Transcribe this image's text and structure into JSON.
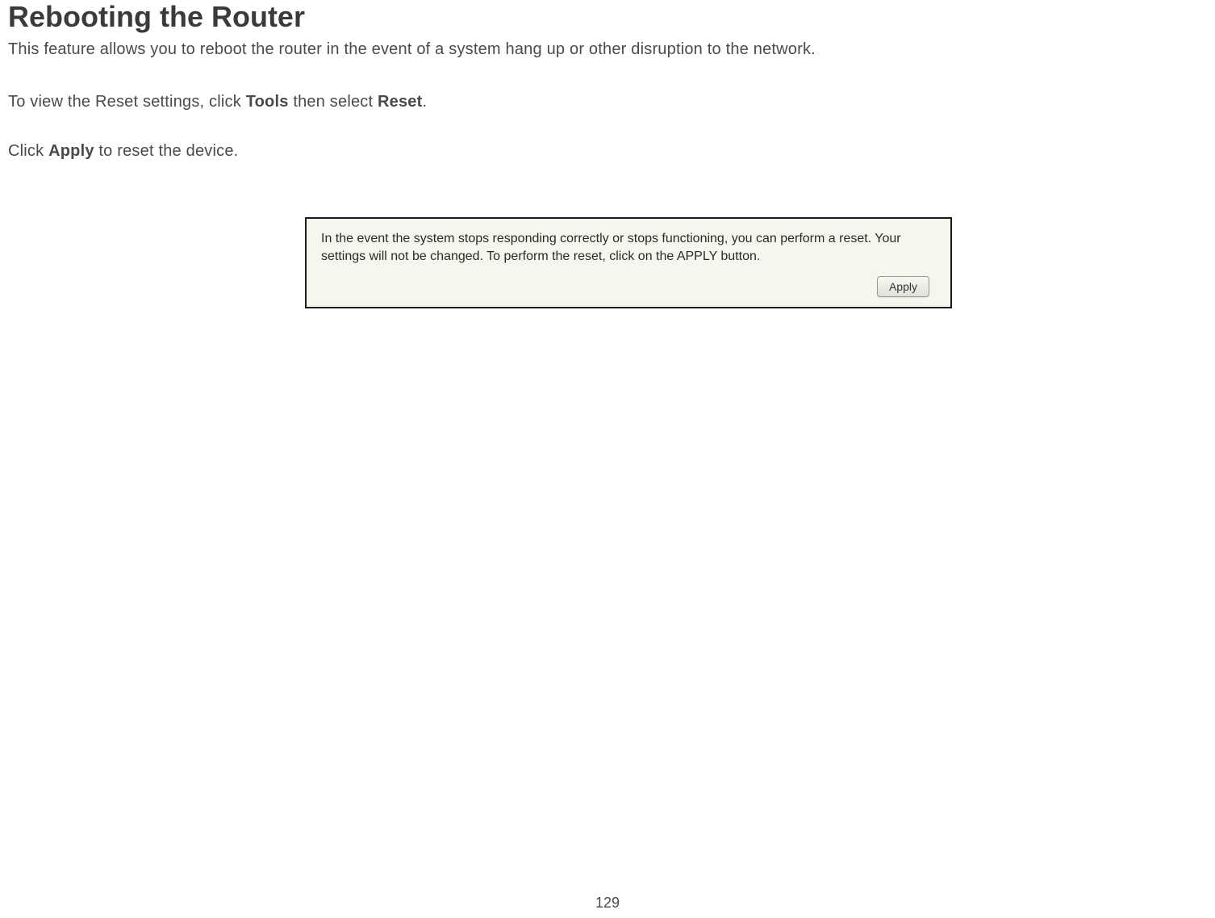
{
  "title": "Rebooting the Router",
  "description": "This feature allows you to reboot the router in the event of a system hang up or other disruption to the network.",
  "instruction1": {
    "prefix": "To view the Reset settings, click ",
    "bold1": "Tools",
    "mid": " then select ",
    "bold2": "Reset",
    "suffix": "."
  },
  "instruction2": {
    "prefix": "Click ",
    "bold1": "Apply",
    "suffix": " to reset the device."
  },
  "panel": {
    "text": "In the event the system stops responding correctly or stops functioning, you can perform a reset. Your settings will not be changed. To perform the reset, click on the APPLY button.",
    "buttonLabel": "Apply"
  },
  "pageNumber": "129"
}
